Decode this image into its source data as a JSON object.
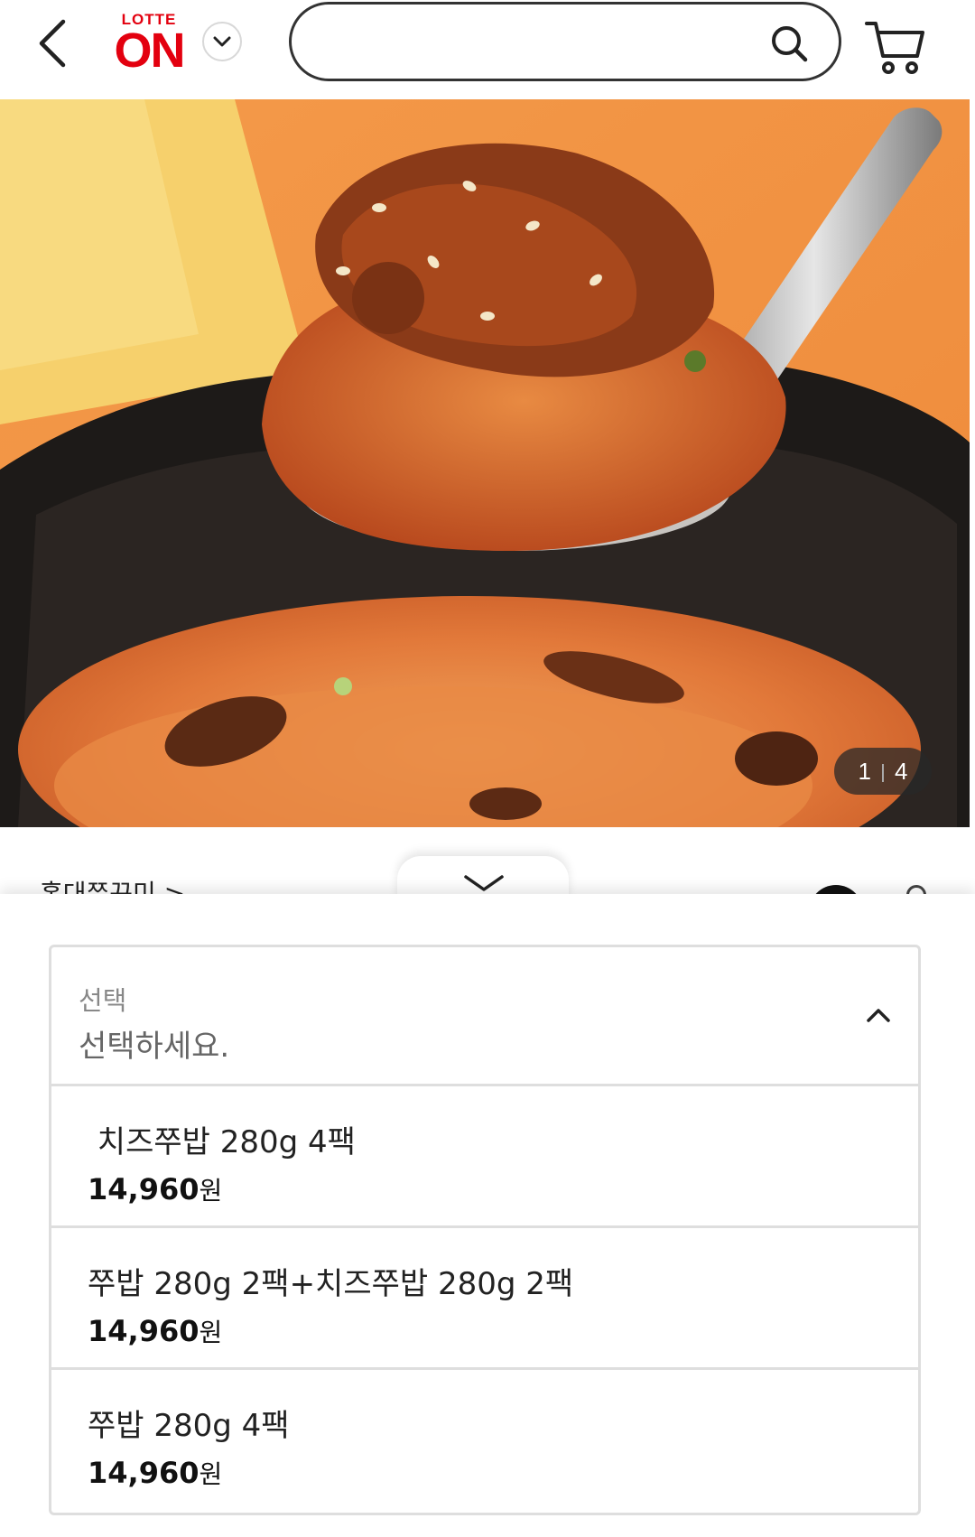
{
  "header": {
    "logo_top": "LOTTE",
    "logo_main": "ON",
    "search_value": "",
    "brand_color": "#e3000f"
  },
  "icons": {
    "back": "chevron-left-icon",
    "dropdown": "chevron-down-icon",
    "search": "search-icon",
    "cart": "cart-icon"
  },
  "gallery": {
    "current": "1",
    "total": "4"
  },
  "brand_peek": "홍대쭈꾸미 >",
  "option_select": {
    "label": "선택",
    "placeholder": "선택하세요.",
    "options": [
      {
        "name": " 치즈쭈밥 280g 4팩",
        "price": "14,960",
        "unit": "원"
      },
      {
        "name": "쭈밥 280g 2팩+치즈쭈밥 280g 2팩",
        "price": "14,960",
        "unit": "원"
      },
      {
        "name": "쭈밥 280g 4팩",
        "price": "14,960",
        "unit": "원"
      }
    ]
  }
}
